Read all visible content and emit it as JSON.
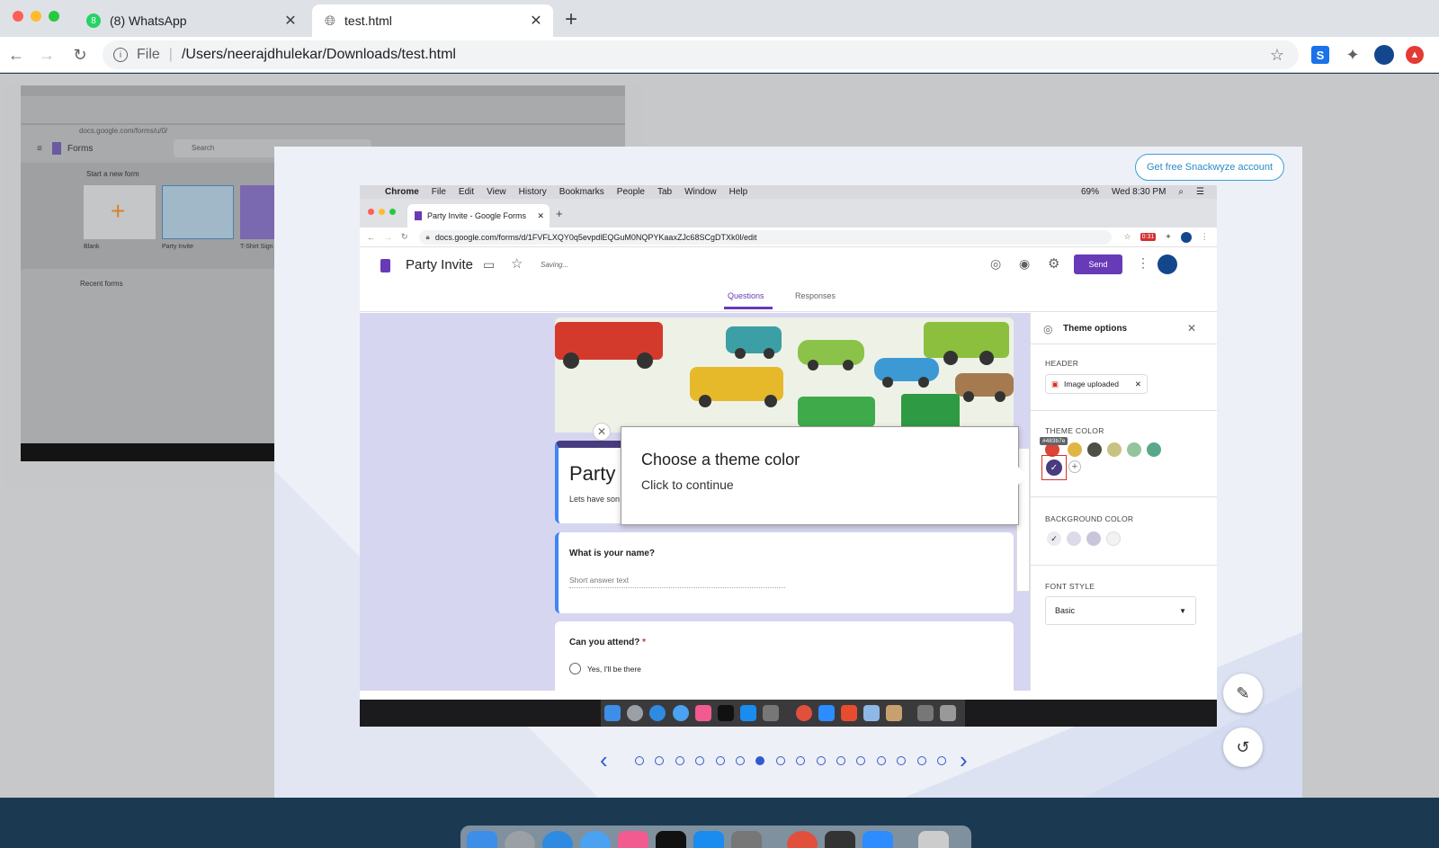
{
  "browser": {
    "tabs": [
      {
        "title": "(8) WhatsApp",
        "badge": "8"
      },
      {
        "title": "test.html"
      }
    ],
    "address_scheme": "File",
    "address_path": "/Users/neerajdhulekar/Downloads/test.html",
    "profile_initial": "S"
  },
  "background_shot": {
    "app_name": "Forms",
    "search_placeholder": "Search",
    "url": "docs.google.com/forms/u/0/",
    "start_new": "Start a new form",
    "templates": [
      "Blank",
      "Party Invite",
      "T-Shirt Sign"
    ],
    "recent": "Recent forms"
  },
  "overlay": {
    "cta_label": "Get free Snackwyze account"
  },
  "shot": {
    "mac_menu": [
      "Chrome",
      "File",
      "Edit",
      "View",
      "History",
      "Bookmarks",
      "People",
      "Tab",
      "Window",
      "Help"
    ],
    "mac_status": {
      "battery": "69%",
      "time": "Wed 8:30 PM"
    },
    "inner_tab": "Party Invite - Google Forms",
    "inner_url": "docs.google.com/forms/d/1FVFLXQY0q5evpdlEQGuM0NQPYKaaxZJc68SCgDTXk0l/edit",
    "ext_badge": "0:31",
    "form_title": "Party Invite",
    "saving": "Saving...",
    "send_label": "Send",
    "tabs": [
      "Questions",
      "Responses"
    ],
    "card_title": "Party",
    "card_desc": "Lets have son",
    "q1": {
      "title": "What is your name?",
      "placeholder": "Short answer text"
    },
    "q2": {
      "title": "Can you attend?",
      "required": "*",
      "option1": "Yes,  I'll be there"
    },
    "theme": {
      "title": "Theme options",
      "header_label": "HEADER",
      "header_chip": "Image uploaded",
      "theme_color_label": "THEME COLOR",
      "tooltip": "#483b7e",
      "bg_color_label": "BACKGROUND COLOR",
      "font_label": "FONT STYLE",
      "font_value": "Basic"
    }
  },
  "popup": {
    "title": "Choose a theme color",
    "subtitle": "Click to continue"
  },
  "pagination": {
    "count": 16,
    "active_index": 6
  },
  "colors": {
    "form_purple": "#673ab7",
    "selected_theme": "#483b7e",
    "accent_blue": "#2f5bd3"
  }
}
